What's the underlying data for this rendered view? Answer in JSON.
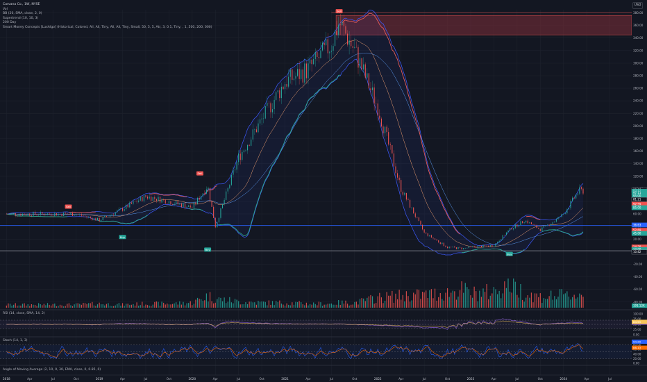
{
  "header": {
    "title": "Carvana Co., 1W, NYSE",
    "vol": "Vol",
    "bb": "BB (20, SMA, close, 2, 0)",
    "supertrend": "Supertrend (10, 10, 3)",
    "ma200": "200 Day",
    "smc": "Smart Money Concepts [LuxAlgo] (Historical, Colored, All, All, Tiny, All, All, Tiny, Small, 50, 5, 5, Atr, 3, 0.1, Tiny, , 1, 500, 200, 000)",
    "currency": "USD"
  },
  "panes": {
    "rsi_label": "RSI (14, close, SMA, 14, 2)",
    "stoch_label": "Stoch (14, 1, 3)",
    "ama_label": "Angle of Moving Average (2, 10, 0, 30, EMA, close, 0, 0.85, 0)"
  },
  "colors": {
    "background": "#131722",
    "grid": "#1e222d",
    "up": "#26a69a",
    "down": "#ef5350",
    "blue": "#2962ff",
    "bb": "#3d5afe",
    "supertrend_up": "#2ca687",
    "supertrend_down": "#e45a5a",
    "zone": "#7e2d38",
    "rsi": "#7e57c2",
    "stoch_k": "#2962ff",
    "stoch_d": "#ff6d00"
  },
  "chart_data": {
    "type": "candlestick",
    "x": [
      "2018-10",
      "2019-01",
      "2019-04",
      "2019-07",
      "2019-10",
      "2020-01",
      "2020-03",
      "2020-04",
      "2020-07",
      "2020-10",
      "2021-01",
      "2021-04",
      "2021-07",
      "2021-08",
      "2021-10",
      "2022-01",
      "2022-04",
      "2022-07",
      "2022-10",
      "2022-12",
      "2023-01",
      "2023-04",
      "2023-06",
      "2023-08",
      "2023-10",
      "2023-12",
      "2024-01",
      "2024-03"
    ],
    "close": [
      60,
      50,
      68,
      88,
      80,
      70,
      105,
      40,
      150,
      210,
      270,
      290,
      330,
      365,
      320,
      230,
      100,
      30,
      7,
      5,
      7,
      10,
      35,
      50,
      35,
      50,
      60,
      97
    ],
    "high": [
      65,
      70,
      72,
      92,
      90,
      95,
      118,
      60,
      175,
      240,
      310,
      320,
      365,
      376,
      340,
      250,
      120,
      42,
      14,
      10,
      10,
      18,
      46,
      58,
      52,
      58,
      72,
      100
    ],
    "low": [
      45,
      40,
      55,
      70,
      68,
      60,
      22,
      22,
      100,
      160,
      220,
      230,
      290,
      300,
      280,
      150,
      60,
      20,
      4,
      3.5,
      4,
      6,
      20,
      38,
      29,
      40,
      45,
      75
    ],
    "volume": [
      3,
      4,
      3,
      4,
      4,
      5,
      12,
      9,
      6,
      5,
      5,
      4,
      4,
      5,
      5,
      10,
      12,
      13,
      15,
      18,
      14,
      16,
      26,
      14,
      11,
      12,
      12,
      13
    ],
    "x_ticks": [
      "2018",
      "Apr",
      "Jul",
      "Oct",
      "2019",
      "Apr",
      "Jul",
      "Oct",
      "2020",
      "Apr",
      "Jul",
      "Oct",
      "2021",
      "Apr",
      "Jul",
      "Oct",
      "2022",
      "Apr",
      "Jul",
      "Oct",
      "2023",
      "Apr",
      "Jul",
      "Oct",
      "2024",
      "Apr",
      "Jul"
    ],
    "y_ticks": [
      "380.00",
      "360.00",
      "340.00",
      "320.00",
      "300.00",
      "280.00",
      "260.00",
      "240.00",
      "220.00",
      "200.00",
      "180.00",
      "160.00",
      "140.00",
      "120.00",
      "100.00",
      "80.00",
      "60.00",
      "40.00",
      "20.00",
      "0.0000",
      "-20.00",
      "-40.00",
      "-60.00",
      "-80.00"
    ],
    "ylim": [
      -88,
      385
    ],
    "horizontal_lines": [
      {
        "value": 42.0,
        "color": "#2962ff"
      },
      {
        "value": 1.44,
        "color": "#787b86"
      }
    ],
    "zone": {
      "top": 376,
      "bottom": 345,
      "label": ""
    },
    "signals": [
      {
        "label": "Sell",
        "x": "2018-09",
        "price": 65
      },
      {
        "label": "Buy",
        "x": "2019-04",
        "price": 30
      },
      {
        "label": "Sell",
        "x": "2020-02",
        "price": 118
      },
      {
        "label": "Buy",
        "x": "2020-03",
        "price": 10
      },
      {
        "label": "Sell",
        "x": "2021-08",
        "price": 376
      },
      {
        "label": "Buy",
        "x": "2023-06",
        "price": 3
      }
    ],
    "price_tags": [
      {
        "text": "98.98",
        "value": 97.9,
        "color": "#131722"
      },
      {
        "text": "97.11",
        "value": 96.2,
        "color": "#26a69a"
      },
      {
        "text": "97.11",
        "value": 93.5,
        "color": "#26a69a"
      },
      {
        "text": "95.00",
        "value": 88.5,
        "color": "#26a69a"
      },
      {
        "text": "81.21",
        "value": 83.0,
        "color": "#131722"
      },
      {
        "text": "92.59",
        "value": 75.5,
        "color": "#ef5350"
      },
      {
        "text": "85.00",
        "value": 70.0,
        "color": "#26a69a"
      },
      {
        "text": "36.63",
        "value": 42.5,
        "color": "#2962ff"
      },
      {
        "text": "52.69",
        "value": 34.0,
        "color": "#ef5350"
      },
      {
        "text": "45.00",
        "value": 29.0,
        "color": "#26a69a"
      },
      {
        "text": "14.28",
        "value": 7.5,
        "color": "#ef5350"
      },
      {
        "text": "14.00",
        "value": 3.5,
        "color": "#26a69a"
      },
      {
        "text": "10.82",
        "value": -0.5,
        "color": "#131722"
      }
    ],
    "volume_tag": "191.12K",
    "rsi": {
      "ticks": [
        "100.00",
        "75.00",
        "50.00",
        "25.00",
        "0.00"
      ],
      "tags": [
        "58.58",
        "64.93"
      ]
    },
    "stoch": {
      "ticks": [
        "80.00",
        "60.00",
        "40.00",
        "20.00",
        "0.00"
      ],
      "tags": [
        "94.29",
        "88.13"
      ]
    }
  }
}
